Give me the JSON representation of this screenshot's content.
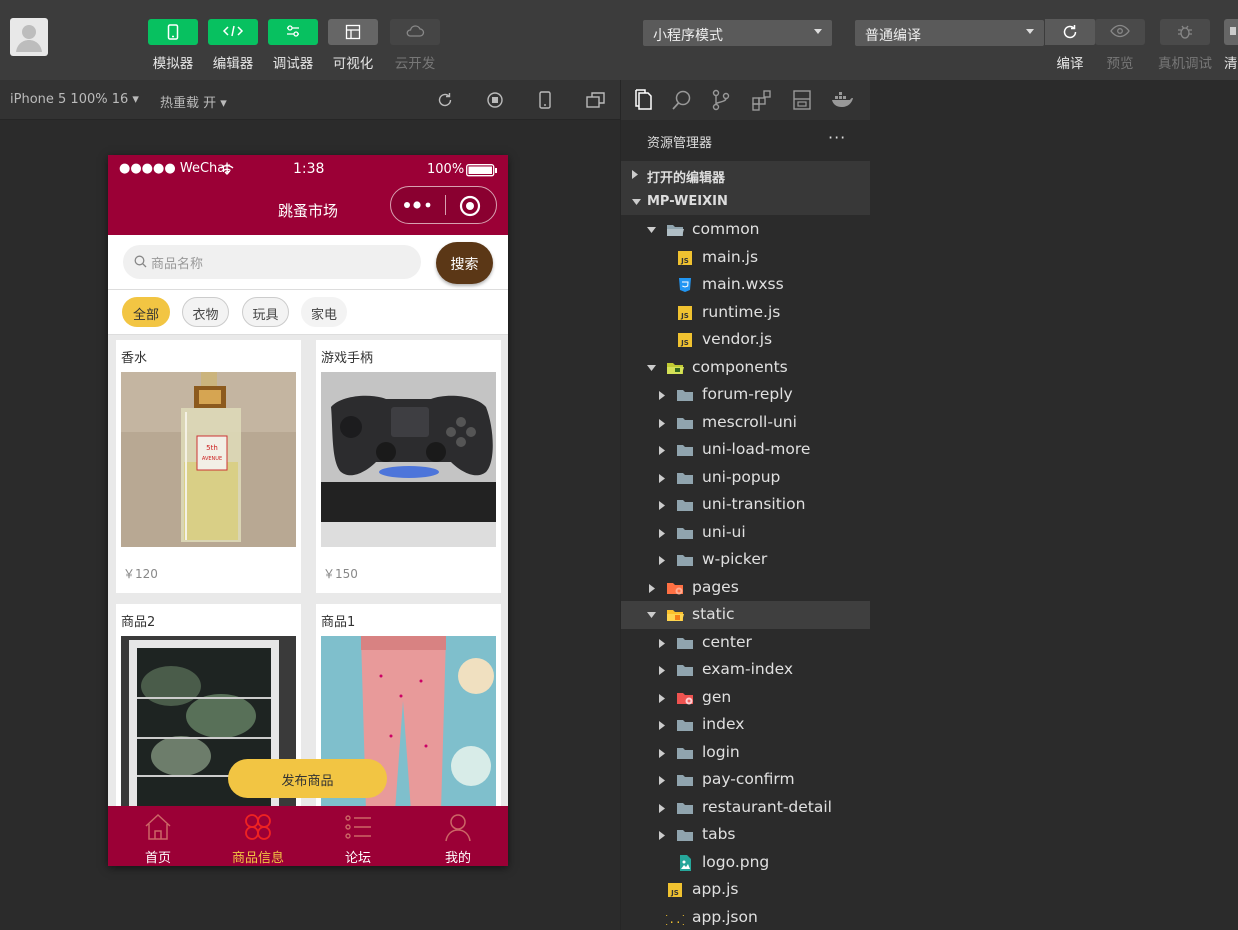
{
  "toolbar": {
    "buttons": [
      {
        "label": "模拟器",
        "icon": "phone-icon"
      },
      {
        "label": "编辑器",
        "icon": "code-icon"
      },
      {
        "label": "调试器",
        "icon": "sliders-icon"
      },
      {
        "label": "可视化",
        "icon": "layout-icon"
      },
      {
        "label": "云开发",
        "icon": "cloud-icon"
      }
    ],
    "mode_select": "小程序模式",
    "compile_select": "普通编译",
    "actions": [
      {
        "label": "编译",
        "icon": "refresh-icon"
      },
      {
        "label": "预览",
        "icon": "eye-icon"
      },
      {
        "label": "真机调试",
        "icon": "bug-icon"
      },
      {
        "label": "清",
        "icon": "clear-icon"
      }
    ]
  },
  "simulator_bar": {
    "device": "iPhone 5 100% 16",
    "hot_reload": "热重载 开"
  },
  "phone": {
    "status": {
      "carrier": "●●●●● WeChat",
      "time": "1:38",
      "battery": "100%"
    },
    "nav_title": "跳蚤市场",
    "search": {
      "placeholder": "商品名称",
      "button": "搜索"
    },
    "categories": [
      "全部",
      "衣物",
      "玩具",
      "家电"
    ],
    "products": [
      {
        "name": "香水",
        "price": "￥120"
      },
      {
        "name": "游戏手柄",
        "price": "￥150"
      },
      {
        "name": "商品2",
        "price": ""
      },
      {
        "name": "商品1",
        "price": ""
      }
    ],
    "publish_button": "发布商品",
    "tabs": [
      {
        "label": "首页",
        "icon": "home-icon"
      },
      {
        "label": "商品信息",
        "icon": "grid-icon"
      },
      {
        "label": "论坛",
        "icon": "list-icon"
      },
      {
        "label": "我的",
        "icon": "user-icon"
      }
    ],
    "colors": {
      "brand": "#9b0036",
      "accent": "#f2c543",
      "search_button": "#5b3716"
    }
  },
  "explorer": {
    "title": "资源管理器",
    "more": "···",
    "sections": {
      "open_editors": "打开的编辑器",
      "project": "MP-WEIXIN"
    },
    "tree": [
      {
        "name": "common",
        "level": 1,
        "kind": "folder-open"
      },
      {
        "name": "main.js",
        "level": 2,
        "kind": "js"
      },
      {
        "name": "main.wxss",
        "level": 2,
        "kind": "css"
      },
      {
        "name": "runtime.js",
        "level": 2,
        "kind": "js"
      },
      {
        "name": "vendor.js",
        "level": 2,
        "kind": "js"
      },
      {
        "name": "components",
        "level": 1,
        "kind": "folder-components"
      },
      {
        "name": "forum-reply",
        "level": 2,
        "kind": "folder"
      },
      {
        "name": "mescroll-uni",
        "level": 2,
        "kind": "folder"
      },
      {
        "name": "uni-load-more",
        "level": 2,
        "kind": "folder"
      },
      {
        "name": "uni-popup",
        "level": 2,
        "kind": "folder"
      },
      {
        "name": "uni-transition",
        "level": 2,
        "kind": "folder"
      },
      {
        "name": "uni-ui",
        "level": 2,
        "kind": "folder"
      },
      {
        "name": "w-picker",
        "level": 2,
        "kind": "folder"
      },
      {
        "name": "pages",
        "level": 1,
        "kind": "folder-pages"
      },
      {
        "name": "static",
        "level": 1,
        "kind": "folder-static",
        "selected": true
      },
      {
        "name": "center",
        "level": 2,
        "kind": "folder"
      },
      {
        "name": "exam-index",
        "level": 2,
        "kind": "folder"
      },
      {
        "name": "gen",
        "level": 2,
        "kind": "folder-gen"
      },
      {
        "name": "index",
        "level": 2,
        "kind": "folder"
      },
      {
        "name": "login",
        "level": 2,
        "kind": "folder"
      },
      {
        "name": "pay-confirm",
        "level": 2,
        "kind": "folder"
      },
      {
        "name": "restaurant-detail",
        "level": 2,
        "kind": "folder"
      },
      {
        "name": "tabs",
        "level": 2,
        "kind": "folder"
      },
      {
        "name": "logo.png",
        "level": 2,
        "kind": "image"
      },
      {
        "name": "app.js",
        "level": 1,
        "kind": "js"
      },
      {
        "name": "app.json",
        "level": 1,
        "kind": "json"
      }
    ]
  }
}
